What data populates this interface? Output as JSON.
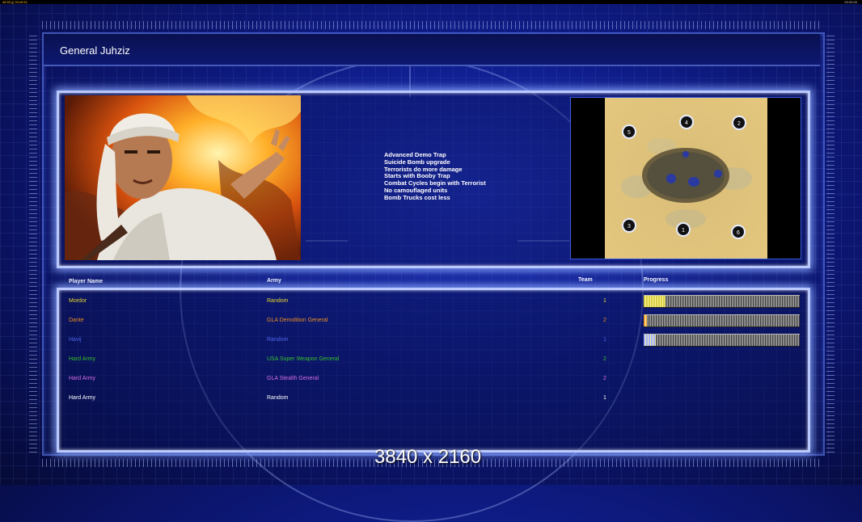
{
  "status_bar": {
    "left_text": "48 50 ||| 00:49:51",
    "right_text": "00:00:00"
  },
  "general_name": "General Juhziz",
  "perks": [
    "Advanced Demo Trap",
    "Suicide Bomb upgrade",
    "Terrorists do more damage",
    "Starts with Booby Trap",
    "Combat Cycles begin with Terrorist",
    "No camouflaged units",
    "Bomb Trucks cost less"
  ],
  "map": {
    "start_positions": [
      "5",
      "4",
      "2",
      "3",
      "1",
      "6"
    ]
  },
  "table": {
    "headers": {
      "player": "Player Name",
      "army": "Army",
      "team": "Team",
      "progress": "Progress"
    },
    "rows": [
      {
        "player": "Mordor",
        "army": "Random",
        "team": "1",
        "color": "#e8d832",
        "progress": 0.14,
        "bar_color": "#d8d040"
      },
      {
        "player": "Dante",
        "army": "GLA Demolition General",
        "team": "2",
        "color": "#ef8f1f",
        "progress": 0.02,
        "bar_color": "#f0a030"
      },
      {
        "player": "Havij",
        "army": "Random",
        "team": "1",
        "color": "#4f63e6",
        "progress": 0.08,
        "bar_color": "#a0b0ff"
      },
      {
        "player": "Hard Army",
        "army": "USA Super Weapon General",
        "team": "2",
        "color": "#35c02b",
        "progress": null,
        "bar_color": null
      },
      {
        "player": "Hard Army",
        "army": "GLA Stealth General",
        "team": "2",
        "color": "#d86de5",
        "progress": null,
        "bar_color": null
      },
      {
        "player": "Hard Army",
        "army": "Random",
        "team": "1",
        "color": "#ffffff",
        "progress": null,
        "bar_color": null
      }
    ]
  },
  "resolution_label": "3840 x 2160"
}
